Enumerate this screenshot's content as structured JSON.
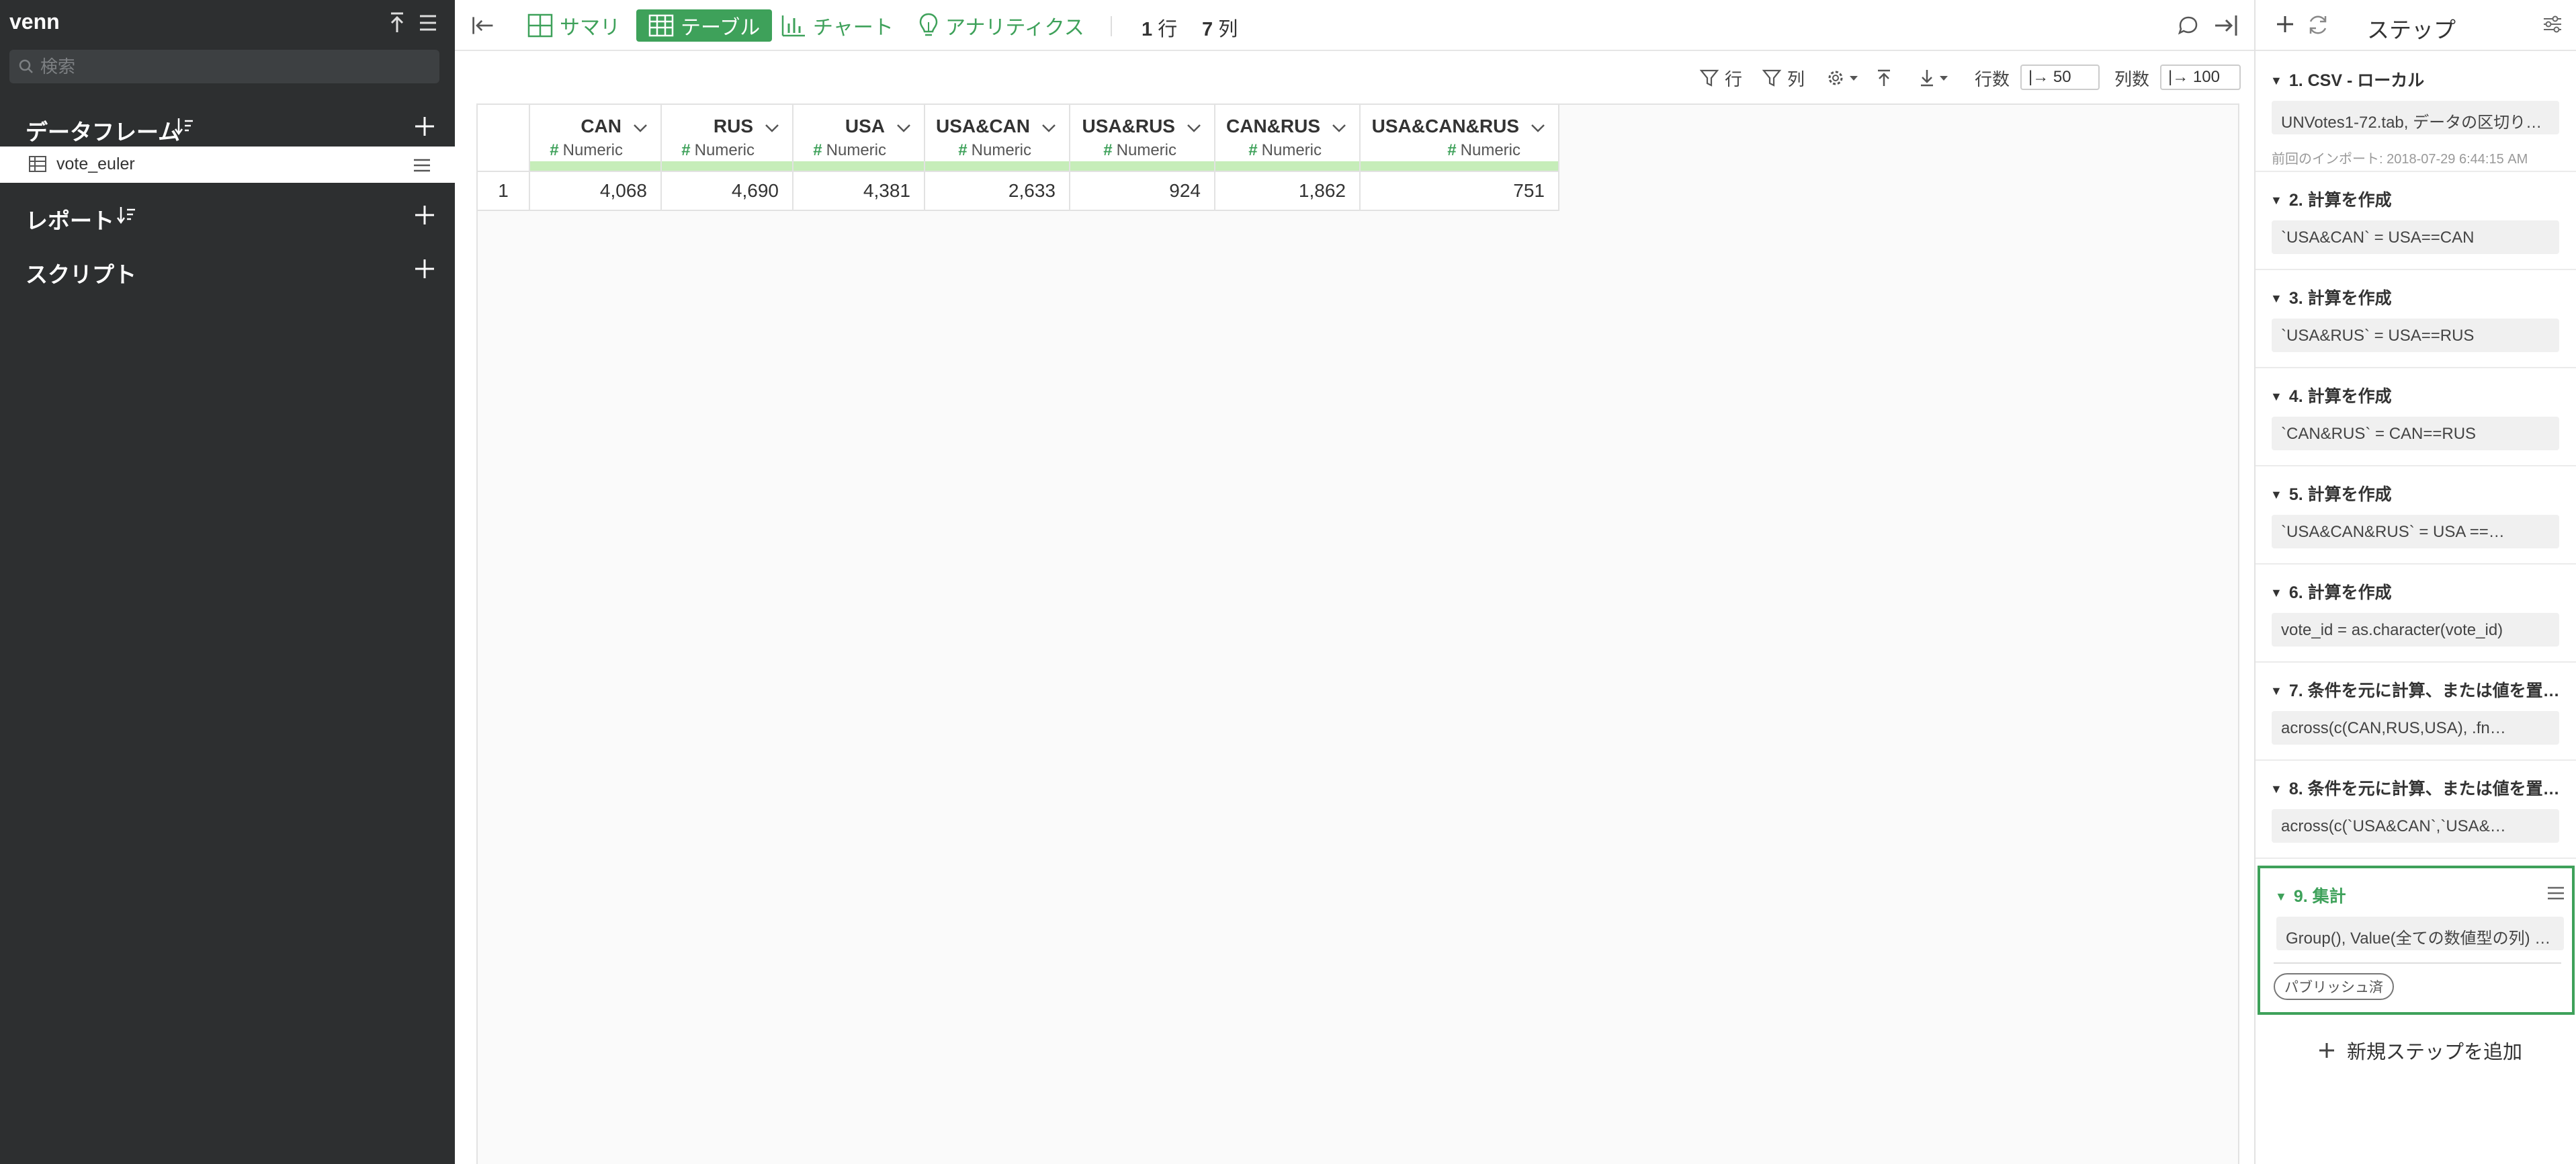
{
  "sidebar": {
    "project_name": "venn",
    "search_placeholder": "検索",
    "sections": {
      "dataframes": "データフレーム",
      "reports": "レポート",
      "scripts": "スクリプト"
    },
    "dataframe_item": "vote_euler"
  },
  "toolbar": {
    "tabs": {
      "summary": "サマリ",
      "table": "テーブル",
      "chart": "チャート",
      "analytics": "アナリティクス"
    },
    "active_tab": "テーブル",
    "rows_count": "1",
    "rows_unit": "行",
    "cols_count": "7",
    "cols_unit": "列"
  },
  "table_toolbar": {
    "filter_row": "行",
    "filter_col": "列",
    "rows_label": "行数",
    "rows_value": "|→ 50",
    "cols_label": "列数",
    "cols_value": "|→ 100"
  },
  "table": {
    "columns": [
      {
        "name": "CAN",
        "type": "Numeric"
      },
      {
        "name": "RUS",
        "type": "Numeric"
      },
      {
        "name": "USA",
        "type": "Numeric"
      },
      {
        "name": "USA&CAN",
        "type": "Numeric"
      },
      {
        "name": "USA&RUS",
        "type": "Numeric"
      },
      {
        "name": "CAN&RUS",
        "type": "Numeric"
      },
      {
        "name": "USA&CAN&RUS",
        "type": "Numeric"
      }
    ],
    "rows": [
      {
        "num": "1",
        "cells": [
          "4,068",
          "4,690",
          "4,381",
          "2,633",
          "924",
          "1,862",
          "751"
        ]
      }
    ]
  },
  "steps_panel": {
    "title": "ステップ",
    "steps": [
      {
        "title": "1. CSV - ローカル",
        "body": "UNVotes1-72.tab, データの区切り…",
        "note": "前回のインポート: 2018-07-29 6:44:15 AM"
      },
      {
        "title": "2. 計算を作成",
        "body": "`USA&CAN` = USA==CAN"
      },
      {
        "title": "3. 計算を作成",
        "body": "`USA&RUS` = USA==RUS"
      },
      {
        "title": "4. 計算を作成",
        "body": "`CAN&RUS` = CAN==RUS"
      },
      {
        "title": "5. 計算を作成",
        "body": "`USA&CAN&RUS` = USA ==…"
      },
      {
        "title": "6. 計算を作成",
        "body": "vote_id = as.character(vote_id)"
      },
      {
        "title": "7. 条件を元に計算、または値を置…",
        "body": "across(c(CAN,RUS,USA), .fn…"
      },
      {
        "title": "8. 条件を元に計算、または値を置…",
        "body": "across(c(`USA&CAN`,`USA&…"
      },
      {
        "title": "9. 集計",
        "body": "Group(), Value(全ての数値型の列) (…",
        "badge": "パブリッシュ済"
      }
    ],
    "add_step": "新規ステップを追加"
  },
  "colors": {
    "sidebar_bg": "#2d2f30",
    "accent_green": "#3ea15a",
    "type_bar": "#c6edb9"
  }
}
